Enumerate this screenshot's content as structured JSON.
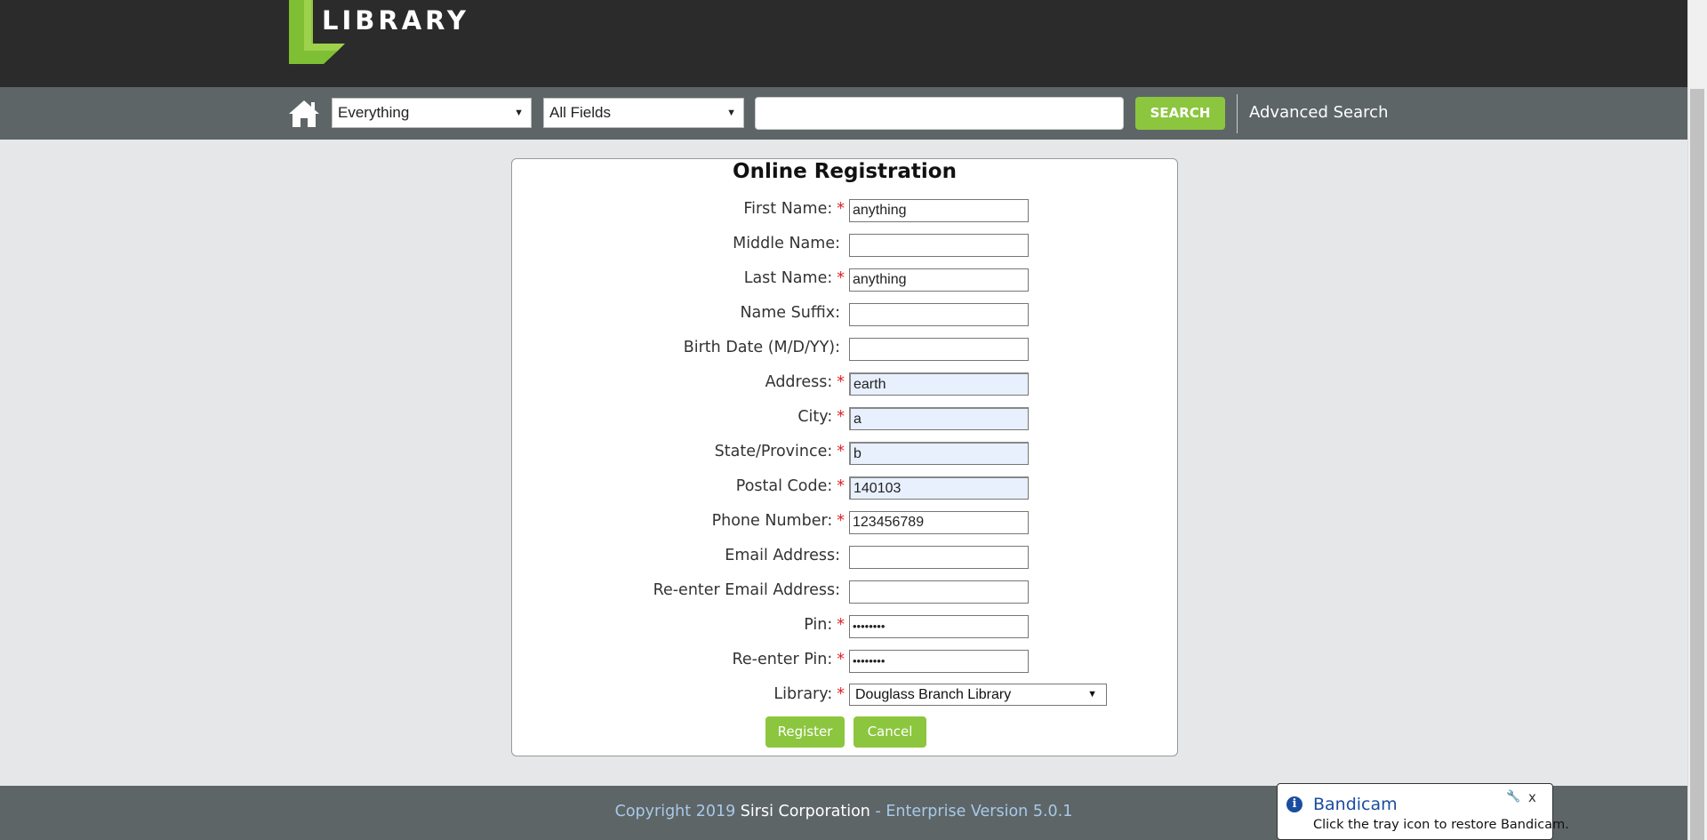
{
  "header": {
    "logo_text": "LIBRARY"
  },
  "search": {
    "scope_selected": "Everything",
    "field_selected": "All Fields",
    "query_value": "",
    "search_label": "SEARCH",
    "advanced_label": "Advanced Search"
  },
  "form": {
    "title": "Online Registration",
    "fields": [
      {
        "label": "First Name:",
        "required": "*",
        "value": "anything"
      },
      {
        "label": "Middle Name:",
        "required": "",
        "value": ""
      },
      {
        "label": "Last Name:",
        "required": "*",
        "value": "anything"
      },
      {
        "label": "Name Suffix:",
        "required": "",
        "value": ""
      },
      {
        "label": "Birth Date (M/D/YY):",
        "required": "",
        "value": ""
      },
      {
        "label": "Address:",
        "required": "*",
        "value": "earth"
      },
      {
        "label": "City:",
        "required": "*",
        "value": "a"
      },
      {
        "label": "State/Province:",
        "required": "*",
        "value": "b"
      },
      {
        "label": "Postal Code:",
        "required": "*",
        "value": "140103"
      },
      {
        "label": "Phone Number:",
        "required": "*",
        "value": "123456789"
      },
      {
        "label": "Email Address:",
        "required": "",
        "value": ""
      },
      {
        "label": "Re-enter Email Address:",
        "required": "",
        "value": ""
      },
      {
        "label": "Pin:",
        "required": "*",
        "value": "••••••••"
      },
      {
        "label": "Re-enter Pin:",
        "required": "*",
        "value": "••••••••"
      }
    ],
    "library": {
      "label": "Library:",
      "required": "*",
      "value": "Douglass Branch Library"
    },
    "register_label": "Register",
    "cancel_label": "Cancel"
  },
  "footer": {
    "copyright_prefix": "Copyright 2019 ",
    "company": "Sirsi Corporation",
    "version": " - Enterprise Version 5.0.1"
  },
  "notification": {
    "title": "Bandicam",
    "message": "Click the tray icon to restore Bandicam.",
    "close_glyph": "x"
  },
  "colors": {
    "accent_green": "#8cc63f",
    "header_dark": "#2b2b2b",
    "bar_gray": "#5d6567",
    "required_red": "#e02020",
    "autofill_blue": "#e8f0fe"
  }
}
